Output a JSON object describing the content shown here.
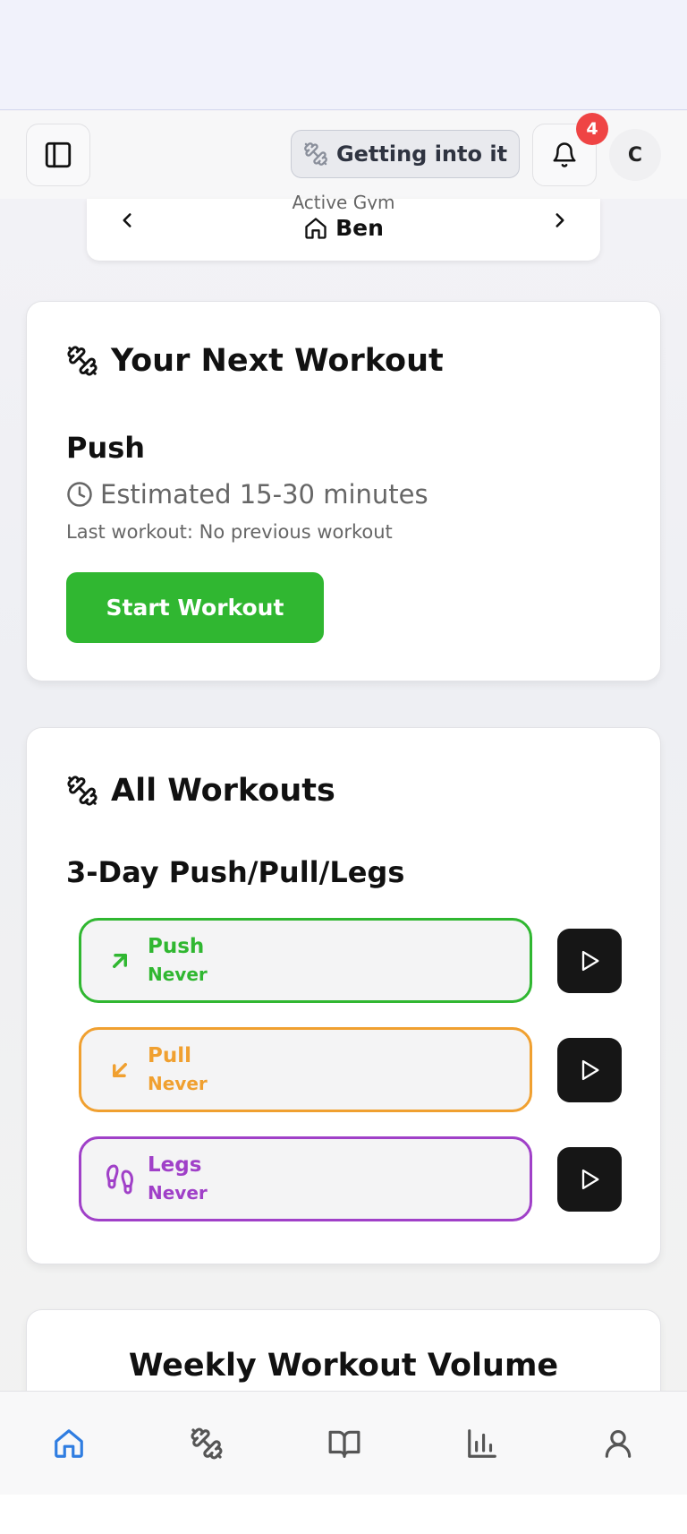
{
  "header": {
    "level_label": "Getting into it",
    "notification_count": "4",
    "avatar_initial": "C"
  },
  "gym": {
    "label": "Active Gym",
    "name": "Ben"
  },
  "next_workout": {
    "title": "Your Next Workout",
    "name": "Push",
    "estimate": "Estimated 15-30 minutes",
    "last": "Last workout: No previous workout",
    "start_label": "Start Workout"
  },
  "all_workouts": {
    "title": "All Workouts",
    "program": "3-Day Push/Pull/Legs",
    "items": [
      {
        "name": "Push",
        "last": "Never",
        "color": "#30b731",
        "icon": "arrow-up-right-icon"
      },
      {
        "name": "Pull",
        "last": "Never",
        "color": "#f0a030",
        "icon": "arrow-down-left-icon"
      },
      {
        "name": "Legs",
        "last": "Never",
        "color": "#a040c8",
        "icon": "footprints-icon"
      }
    ]
  },
  "chart_card": {
    "title": "Weekly Workout Volume"
  },
  "nav": {
    "active_color": "#2f7de1",
    "items": [
      "home-icon",
      "dumbbell-icon",
      "book-icon",
      "chart-icon",
      "user-icon"
    ]
  }
}
